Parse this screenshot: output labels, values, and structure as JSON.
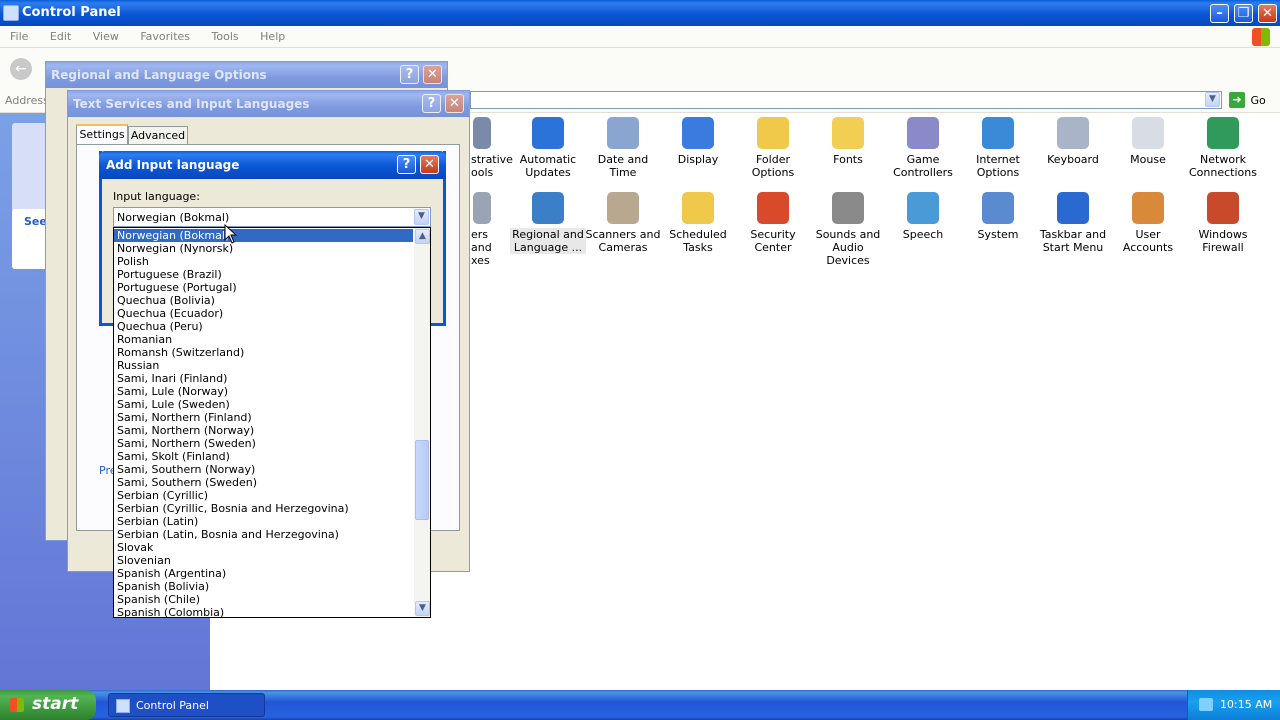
{
  "window": {
    "title": "Control Panel"
  },
  "menu": [
    "File",
    "Edit",
    "View",
    "Favorites",
    "Tools",
    "Help"
  ],
  "toolbar": {
    "address_label": "Address",
    "go_label": "Go"
  },
  "sidebar": {
    "see_also_label": "See"
  },
  "control_panel_items": [
    {
      "label": "strative\nools",
      "icon": "admin-tools-icon",
      "color": "#7a8aa8"
    },
    {
      "label": "Automatic\nUpdates",
      "icon": "windows-update-icon",
      "color": "#2b73d8"
    },
    {
      "label": "Date and Time",
      "icon": "clock-icon",
      "color": "#8aa6d0"
    },
    {
      "label": "Display",
      "icon": "display-icon",
      "color": "#3a7be0"
    },
    {
      "label": "Folder Options",
      "icon": "folder-icon",
      "color": "#f0c84a"
    },
    {
      "label": "Fonts",
      "icon": "fonts-folder-icon",
      "color": "#f2cf52"
    },
    {
      "label": "Game\nControllers",
      "icon": "gamepad-icon",
      "color": "#8a8ac8"
    },
    {
      "label": "Internet\nOptions",
      "icon": "globe-icon",
      "color": "#3a8ad8"
    },
    {
      "label": "Keyboard",
      "icon": "keyboard-icon",
      "color": "#a9b4c8"
    },
    {
      "label": "Mouse",
      "icon": "mouse-icon",
      "color": "#d8dce4"
    },
    {
      "label": "Network\nConnections",
      "icon": "network-icon",
      "color": "#2f9a5a"
    },
    {
      "label": "ers and\nxes",
      "icon": "printer-icon",
      "color": "#9aa4b4"
    },
    {
      "label": "Regional and\nLanguage ...",
      "icon": "regional-globe-icon",
      "color": "#3a7fc8"
    },
    {
      "label": "Scanners and\nCameras",
      "icon": "scanner-icon",
      "color": "#b8a890"
    },
    {
      "label": "Scheduled\nTasks",
      "icon": "scheduled-tasks-icon",
      "color": "#f0c84a"
    },
    {
      "label": "Security\nCenter",
      "icon": "shield-icon",
      "color": "#d84a2a"
    },
    {
      "label": "Sounds and\nAudio Devices",
      "icon": "speaker-icon",
      "color": "#8a8a8a"
    },
    {
      "label": "Speech",
      "icon": "speech-icon",
      "color": "#4a9ad8"
    },
    {
      "label": "System",
      "icon": "system-icon",
      "color": "#5a8ad0"
    },
    {
      "label": "Taskbar and\nStart Menu",
      "icon": "taskbar-icon",
      "color": "#2a6ad0"
    },
    {
      "label": "User Accounts",
      "icon": "users-icon",
      "color": "#d88a3a"
    },
    {
      "label": "Windows\nFirewall",
      "icon": "firewall-icon",
      "color": "#c84a2a"
    }
  ],
  "regional_dialog": {
    "title": "Regional and Language Options"
  },
  "text_services_dialog": {
    "title": "Text Services and Input Languages",
    "tabs": [
      "Settings",
      "Advanced"
    ],
    "pref_label": "Pre"
  },
  "add_input_dialog": {
    "title": "Add Input language",
    "input_language_label": "Input language:",
    "selected_value": "Norwegian (Bokmal)",
    "options": [
      "Norwegian (Bokmal)",
      "Norwegian (Nynorsk)",
      "Polish",
      "Portuguese (Brazil)",
      "Portuguese (Portugal)",
      "Quechua (Bolivia)",
      "Quechua (Ecuador)",
      "Quechua (Peru)",
      "Romanian",
      "Romansh (Switzerland)",
      "Russian",
      "Sami, Inari (Finland)",
      "Sami, Lule (Norway)",
      "Sami, Lule (Sweden)",
      "Sami, Northern (Finland)",
      "Sami, Northern (Norway)",
      "Sami, Northern (Sweden)",
      "Sami, Skolt (Finland)",
      "Sami, Southern (Norway)",
      "Sami, Southern (Sweden)",
      "Serbian (Cyrillic)",
      "Serbian (Cyrillic, Bosnia and Herzegovina)",
      "Serbian (Latin)",
      "Serbian (Latin, Bosnia and Herzegovina)",
      "Slovak",
      "Slovenian",
      "Spanish (Argentina)",
      "Spanish (Bolivia)",
      "Spanish (Chile)",
      "Spanish (Colombia)"
    ],
    "selected_index": 0
  },
  "taskbar": {
    "start_label": "start",
    "task_label": "Control Panel",
    "clock": "10:15 AM"
  },
  "colors": {
    "xp_blue": "#0b56d4",
    "selection": "#316ac5",
    "dialog_face": "#ece9d8"
  }
}
